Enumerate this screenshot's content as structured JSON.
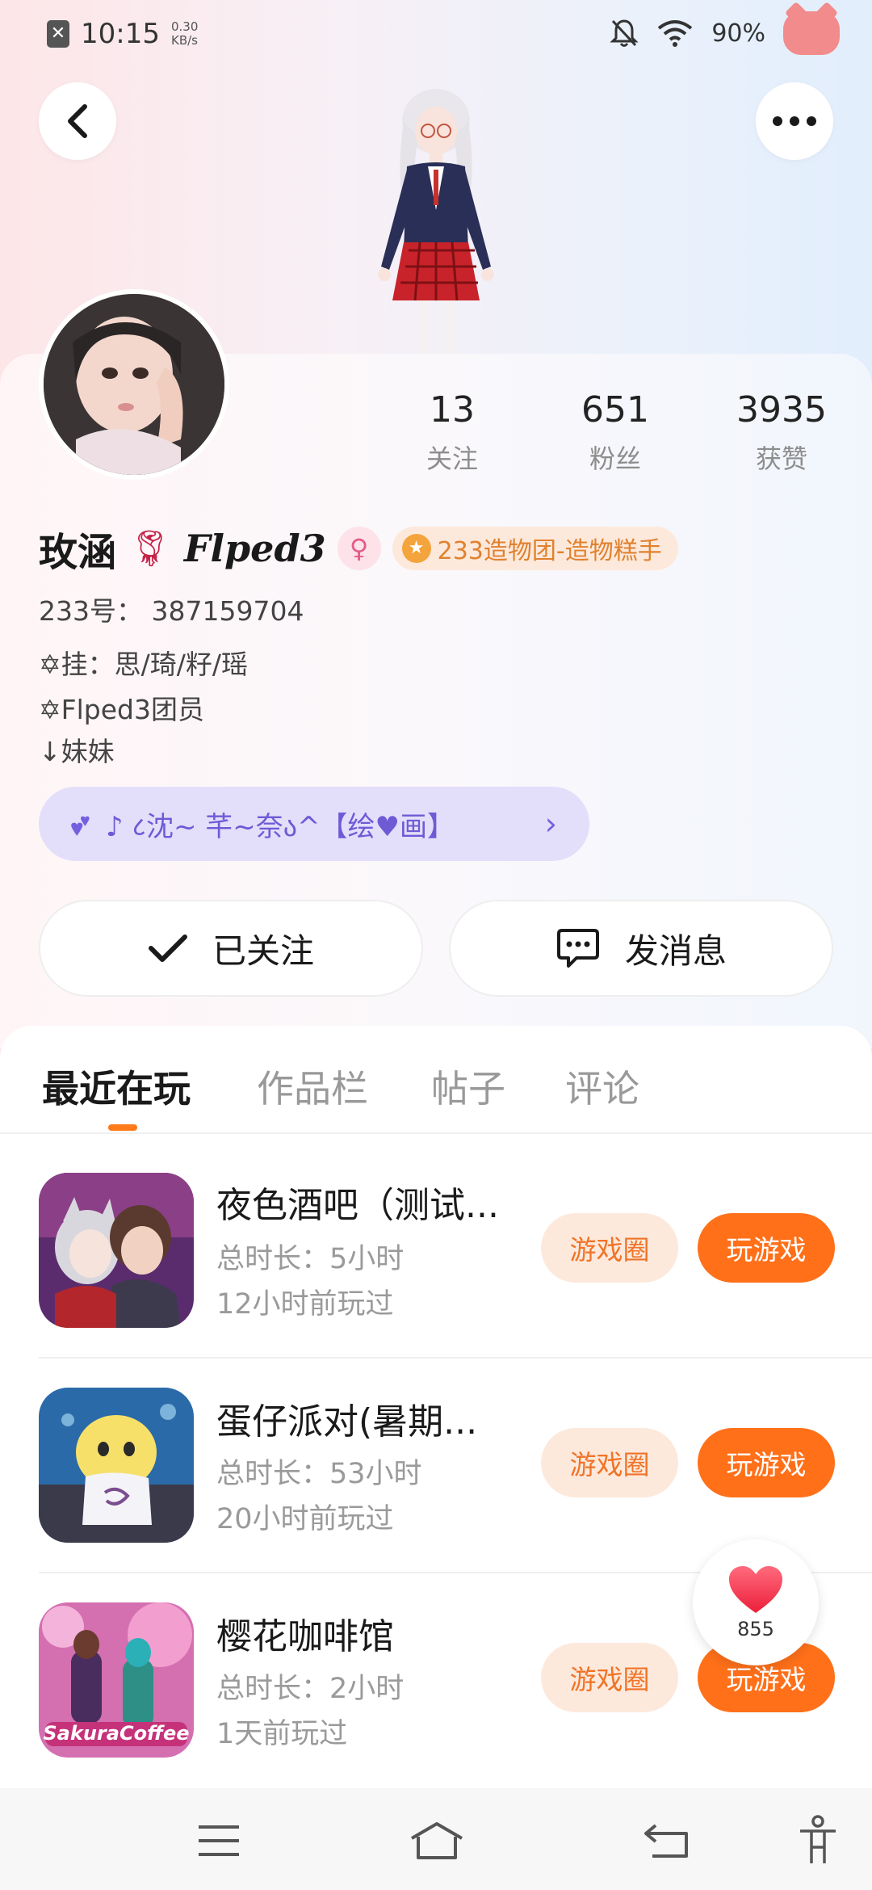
{
  "status_bar": {
    "time": "10:15",
    "speed_value": "0.30",
    "speed_unit": "KB/s",
    "battery": "90%"
  },
  "profile": {
    "stats": [
      {
        "value": "13",
        "label": "关注"
      },
      {
        "value": "651",
        "label": "粉丝"
      },
      {
        "value": "3935",
        "label": "获赞"
      }
    ],
    "name": "玫涵",
    "name_suffix": "Flped3",
    "group_badge": "233造物团-造物糕手",
    "id_line": "233号： 387159704",
    "bio_lines": [
      "✡挂：思/琦/籽/瑶",
      "✡Flped3团员",
      "↓妹妹"
    ],
    "signature": "♪ ८沈~ 芊~奈ა^【绘♥画】"
  },
  "actions": {
    "followed_label": "已关注",
    "message_label": "发消息"
  },
  "tabs": [
    "最近在玩",
    "作品栏",
    "帖子",
    "评论"
  ],
  "games": [
    {
      "title": "夜色酒吧（测试...",
      "duration": "总时长：5小时",
      "last_played": "12小时前玩过",
      "circle_label": "游戏圈",
      "play_label": "玩游戏"
    },
    {
      "title": "蛋仔派对(暑期...",
      "duration": "总时长：53小时",
      "last_played": "20小时前玩过",
      "circle_label": "游戏圈",
      "play_label": "玩游戏"
    },
    {
      "title": "樱花咖啡馆",
      "duration": "总时长：2小时",
      "last_played": "1天前玩过",
      "circle_label": "游戏圈",
      "play_label": "玩游戏"
    }
  ],
  "game3_icon_text": "SakuraCoffee",
  "like_float": {
    "count": "855"
  },
  "colors": {
    "accent": "#ff7019",
    "accent_light": "#fde9dc",
    "signature_bg": "#e3defa",
    "signature_text": "#6f5ad6"
  }
}
